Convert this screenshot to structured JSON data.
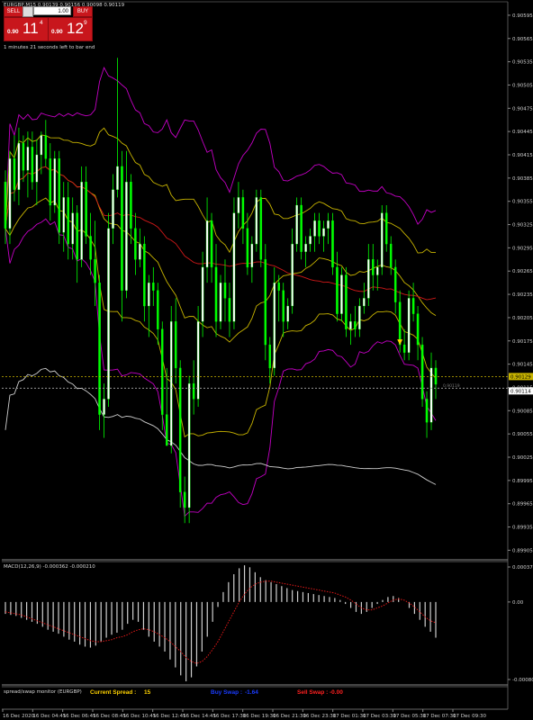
{
  "header": {
    "symbol_line": "EURGBP,M15  0.90139 0.90156 0.90098 0.90119",
    "timer_text": "1 minutes 21 seconds left to bar end"
  },
  "trade_panel": {
    "sell_label": "SELL",
    "buy_label": "BUY",
    "lot_value": "1.00",
    "sell_lead": "0.90",
    "sell_big": "11",
    "sell_sup": "4",
    "buy_lead": "0.90",
    "buy_big": "12",
    "buy_sup": "9"
  },
  "macd_label": "MACD(12,26,9) -0.000362 -0.000210",
  "monitor": {
    "label": "spread/swap monitor (EURGBP)",
    "spread_label": "Current Spread :",
    "spread_value": "15",
    "buy_swap_label": "Buy Swap :",
    "buy_swap_value": "-1.64",
    "sell_swap_label": "Sell Swap :",
    "sell_swap_value": "-0.00"
  },
  "colors": {
    "background": "#000000",
    "candle_up": "#ffffff",
    "candle_down": "#00ff00",
    "band_outer": "#c400c4",
    "band_mid": "#c8b400",
    "ma_red": "#d01818",
    "ma_white": "#cfcfcf",
    "macd_hist": "#cfcfcf",
    "macd_signal": "#e01818",
    "spread_label": "#ffd200",
    "buy_swap": "#1a3cff",
    "sell_swap": "#ff2020"
  },
  "chart_data": {
    "type": "candlestick",
    "symbol": "EURGBP",
    "timeframe": "M15",
    "price_axis": {
      "ticks": [
        "0.90595",
        "0.90565",
        "0.90535",
        "0.90505",
        "0.90475",
        "0.90445",
        "0.90415",
        "0.90385",
        "0.90355",
        "0.90325",
        "0.90295",
        "0.90265",
        "0.90235",
        "0.90205",
        "0.90175",
        "0.90145",
        "0.90115",
        "0.90085",
        "0.90055",
        "0.90025",
        "0.89995",
        "0.89965",
        "0.89935",
        "0.89905"
      ],
      "range": [
        0.89895,
        0.9061
      ]
    },
    "price_tags": {
      "ask": "0.90129",
      "bid": "0.90114",
      "inner": "0.90119"
    },
    "time_axis": {
      "labels": [
        "16 Dec 2020",
        "16 Dec 04:45",
        "16 Dec 06:45",
        "16 Dec 08:45",
        "16 Dec 10:45",
        "16 Dec 12:45",
        "16 Dec 14:45",
        "16 Dec 17:30",
        "16 Dec 19:30",
        "16 Dec 21:30",
        "16 Dec 23:30",
        "17 Dec 01:30",
        "17 Dec 03:30",
        "17 Dec 05:30",
        "17 Dec 07:30",
        "17 Dec 09:30"
      ]
    },
    "candles": [
      [
        0.9038,
        0.90395,
        0.903,
        0.9032
      ],
      [
        0.9032,
        0.9042,
        0.903,
        0.9041
      ],
      [
        0.9041,
        0.9044,
        0.90355,
        0.9037
      ],
      [
        0.9037,
        0.9045,
        0.9035,
        0.9043
      ],
      [
        0.9043,
        0.9044,
        0.9038,
        0.90395
      ],
      [
        0.90395,
        0.90445,
        0.9036,
        0.90425
      ],
      [
        0.90425,
        0.90445,
        0.9037,
        0.9038
      ],
      [
        0.9038,
        0.90435,
        0.9035,
        0.90415
      ],
      [
        0.90415,
        0.90445,
        0.9039,
        0.9044
      ],
      [
        0.9044,
        0.9046,
        0.904,
        0.9041
      ],
      [
        0.9041,
        0.9043,
        0.9033,
        0.9035
      ],
      [
        0.9035,
        0.9042,
        0.9034,
        0.9041
      ],
      [
        0.9041,
        0.9042,
        0.903,
        0.90315
      ],
      [
        0.90315,
        0.9038,
        0.9029,
        0.9036
      ],
      [
        0.9036,
        0.9038,
        0.9028,
        0.903
      ],
      [
        0.903,
        0.9036,
        0.9028,
        0.9034
      ],
      [
        0.9034,
        0.9035,
        0.9025,
        0.9028
      ],
      [
        0.9028,
        0.904,
        0.9027,
        0.9038
      ],
      [
        0.9038,
        0.904,
        0.903,
        0.9031
      ],
      [
        0.9031,
        0.9034,
        0.9026,
        0.9028
      ],
      [
        0.9028,
        0.9033,
        0.9022,
        0.9025
      ],
      [
        0.9025,
        0.9026,
        0.9006,
        0.9008
      ],
      [
        0.9008,
        0.9012,
        0.9005,
        0.901
      ],
      [
        0.901,
        0.9034,
        0.9009,
        0.9032
      ],
      [
        0.9032,
        0.9039,
        0.903,
        0.9037
      ],
      [
        0.9037,
        0.9054,
        0.9036,
        0.904
      ],
      [
        0.904,
        0.9042,
        0.902,
        0.9024
      ],
      [
        0.9024,
        0.9042,
        0.9023,
        0.9038
      ],
      [
        0.9038,
        0.9039,
        0.903,
        0.9032
      ],
      [
        0.9032,
        0.9034,
        0.9026,
        0.9028
      ],
      [
        0.9028,
        0.9032,
        0.9027,
        0.903
      ],
      [
        0.903,
        0.9031,
        0.902,
        0.9022
      ],
      [
        0.9022,
        0.9026,
        0.9018,
        0.9025
      ],
      [
        0.9025,
        0.9027,
        0.9022,
        0.9024
      ],
      [
        0.9024,
        0.9025,
        0.9017,
        0.9019
      ],
      [
        0.9019,
        0.902,
        0.9006,
        0.9008
      ],
      [
        0.9008,
        0.9014,
        0.9004,
        0.9004
      ],
      [
        0.9004,
        0.9022,
        0.9003,
        0.902
      ],
      [
        0.902,
        0.9023,
        0.9012,
        0.9014
      ],
      [
        0.9014,
        0.9015,
        0.8996,
        0.8998
      ],
      [
        0.8998,
        0.9,
        0.8994,
        0.8996
      ],
      [
        0.8996,
        0.9013,
        0.8994,
        0.9012
      ],
      [
        0.9012,
        0.9015,
        0.9008,
        0.901
      ],
      [
        0.901,
        0.9022,
        0.9009,
        0.902
      ],
      [
        0.902,
        0.9029,
        0.9018,
        0.9027
      ],
      [
        0.9027,
        0.9036,
        0.9025,
        0.9033
      ],
      [
        0.9033,
        0.9034,
        0.9025,
        0.9027
      ],
      [
        0.9027,
        0.903,
        0.9018,
        0.902
      ],
      [
        0.902,
        0.9026,
        0.9019,
        0.9025
      ],
      [
        0.9025,
        0.9028,
        0.902,
        0.9023
      ],
      [
        0.9023,
        0.9025,
        0.9018,
        0.902
      ],
      [
        0.902,
        0.9036,
        0.9019,
        0.9034
      ],
      [
        0.9034,
        0.9038,
        0.9032,
        0.9036
      ],
      [
        0.9036,
        0.9037,
        0.903,
        0.9032
      ],
      [
        0.9032,
        0.9034,
        0.9026,
        0.9027
      ],
      [
        0.9027,
        0.9031,
        0.9025,
        0.903
      ],
      [
        0.903,
        0.9037,
        0.9029,
        0.9036
      ],
      [
        0.9036,
        0.9037,
        0.9027,
        0.9028
      ],
      [
        0.9028,
        0.903,
        0.9015,
        0.9017
      ],
      [
        0.9017,
        0.9018,
        0.9012,
        0.9014
      ],
      [
        0.9014,
        0.9027,
        0.9013,
        0.9025
      ],
      [
        0.9025,
        0.9026,
        0.902,
        0.9024
      ],
      [
        0.9024,
        0.9025,
        0.9018,
        0.902
      ],
      [
        0.902,
        0.9023,
        0.9019,
        0.9022
      ],
      [
        0.9022,
        0.9032,
        0.9021,
        0.903
      ],
      [
        0.903,
        0.9036,
        0.9029,
        0.9035
      ],
      [
        0.9035,
        0.9036,
        0.9028,
        0.9029
      ],
      [
        0.9029,
        0.9031,
        0.9027,
        0.903
      ],
      [
        0.903,
        0.9032,
        0.9029,
        0.9031
      ],
      [
        0.9031,
        0.9034,
        0.9029,
        0.9033
      ],
      [
        0.9033,
        0.9034,
        0.903,
        0.9031
      ],
      [
        0.9031,
        0.9033,
        0.9029,
        0.9032
      ],
      [
        0.9032,
        0.9034,
        0.903,
        0.9033
      ],
      [
        0.9033,
        0.9034,
        0.9026,
        0.9027
      ],
      [
        0.9027,
        0.9029,
        0.902,
        0.9021
      ],
      [
        0.9021,
        0.9027,
        0.902,
        0.9026
      ],
      [
        0.9026,
        0.9027,
        0.9018,
        0.9019
      ],
      [
        0.9019,
        0.9021,
        0.9017,
        0.902
      ],
      [
        0.902,
        0.9022,
        0.9018,
        0.9019
      ],
      [
        0.9019,
        0.9023,
        0.9018,
        0.9022
      ],
      [
        0.9022,
        0.9025,
        0.9021,
        0.9023
      ],
      [
        0.9023,
        0.903,
        0.9022,
        0.9028
      ],
      [
        0.9028,
        0.903,
        0.9024,
        0.9026
      ],
      [
        0.9026,
        0.9028,
        0.9024,
        0.9027
      ],
      [
        0.9027,
        0.9035,
        0.9026,
        0.9034
      ],
      [
        0.9034,
        0.9035,
        0.9029,
        0.903
      ],
      [
        0.903,
        0.9031,
        0.9026,
        0.9027
      ],
      [
        0.9027,
        0.9028,
        0.9021,
        0.90225
      ],
      [
        0.90225,
        0.9024,
        0.9016,
        0.9017
      ],
      [
        0.9017,
        0.9019,
        0.9015,
        0.9016
      ],
      [
        0.9016,
        0.9024,
        0.9015,
        0.9023
      ],
      [
        0.9023,
        0.9025,
        0.902,
        0.9021
      ],
      [
        0.9021,
        0.9022,
        0.9015,
        0.9017
      ],
      [
        0.9017,
        0.9018,
        0.9009,
        0.901
      ],
      [
        0.901,
        0.9011,
        0.9005,
        0.9007
      ],
      [
        0.9007,
        0.9016,
        0.9006,
        0.9014
      ],
      [
        0.9014,
        0.9015,
        0.901,
        0.90119
      ]
    ],
    "macd": {
      "zero_label": "0.00",
      "top_label": "0.000371",
      "bottom_label": "-0.000809",
      "range": [
        -0.000809,
        0.000371
      ],
      "histogram": [
        -0.00012,
        -0.00013,
        -0.00014,
        -0.00016,
        -0.00018,
        -0.0002,
        -0.00022,
        -0.00025,
        -0.00028,
        -0.0003,
        -0.00032,
        -0.00035,
        -0.00038,
        -0.0004,
        -0.00043,
        -0.00045,
        -0.00046,
        -0.00044,
        -0.0004,
        -0.00036,
        -0.00033,
        -0.00031,
        -0.00028,
        -0.00022,
        -0.00018,
        -0.0002,
        -0.00028,
        -0.00035,
        -0.0004,
        -0.00045,
        -0.0005,
        -0.00058,
        -0.00066,
        -0.00074,
        -0.0008,
        -0.00076,
        -0.00065,
        -0.0005,
        -0.00035,
        -0.0002,
        -5e-05,
        0.0001,
        0.0002,
        0.00028,
        0.00034,
        0.00037,
        0.00035,
        0.0003,
        0.00025,
        0.00022,
        0.0002,
        0.00018,
        0.00016,
        0.00014,
        0.00012,
        0.00011,
        0.0001,
        9e-05,
        8e-05,
        7e-05,
        6e-05,
        5e-05,
        4e-05,
        2e-05,
        -2e-05,
        -6e-05,
        -0.0001,
        -0.00012,
        -0.0001,
        -6e-05,
        -2e-05,
        2e-05,
        5e-05,
        6e-05,
        4e-05,
        0.0,
        -6e-05,
        -0.00012,
        -0.00018,
        -0.00025,
        -0.0003,
        -0.00036
      ],
      "signal": [
        -0.0001,
        -0.00011,
        -0.00012,
        -0.00013,
        -0.00015,
        -0.00017,
        -0.00019,
        -0.00021,
        -0.00023,
        -0.00025,
        -0.00027,
        -0.00029,
        -0.00031,
        -0.00033,
        -0.00035,
        -0.00037,
        -0.00039,
        -0.0004,
        -0.0004,
        -0.00039,
        -0.00038,
        -0.00036,
        -0.00035,
        -0.00033,
        -0.0003,
        -0.00028,
        -0.00027,
        -0.00028,
        -0.0003,
        -0.00033,
        -0.00036,
        -0.0004,
        -0.00045,
        -0.0005,
        -0.00056,
        -0.0006,
        -0.00062,
        -0.0006,
        -0.00055,
        -0.00048,
        -0.0004,
        -0.0003,
        -0.0002,
        -0.0001,
        0.0,
        8e-05,
        0.00014,
        0.00018,
        0.0002,
        0.00021,
        0.00021,
        0.0002,
        0.00019,
        0.00018,
        0.00017,
        0.00016,
        0.00015,
        0.00014,
        0.00013,
        0.00012,
        0.00011,
        0.0001,
        9e-05,
        7e-05,
        5e-05,
        2e-05,
        -2e-05,
        -6e-05,
        -8e-05,
        -8e-05,
        -6e-05,
        -4e-05,
        -1e-05,
        2e-05,
        3e-05,
        2e-05,
        -1e-05,
        -5e-05,
        -0.0001,
        -0.00015,
        -0.00019,
        -0.00021
      ]
    }
  }
}
